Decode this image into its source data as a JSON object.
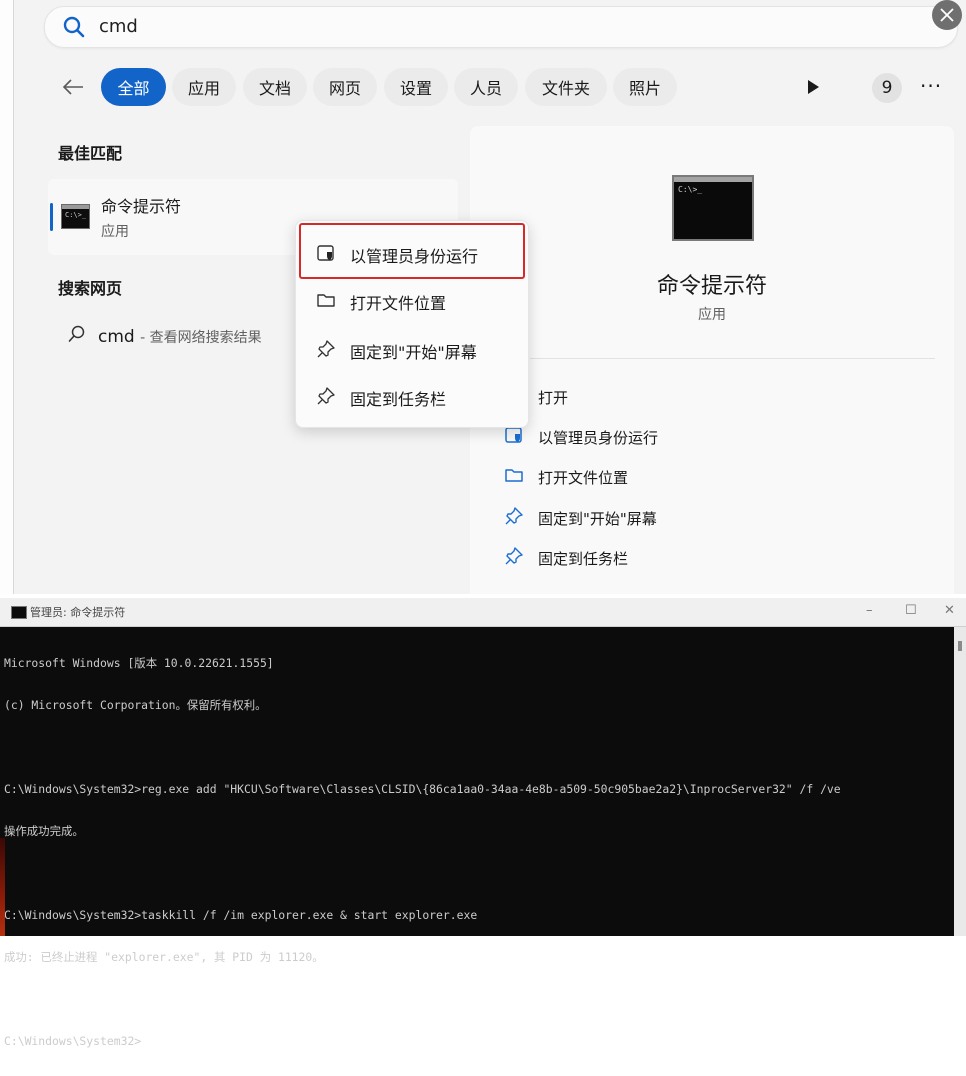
{
  "search": {
    "query": "cmd"
  },
  "filters": {
    "tabs": [
      "全部",
      "应用",
      "文档",
      "网页",
      "设置",
      "人员",
      "文件夹",
      "照片"
    ],
    "count": "9",
    "more": "···"
  },
  "results": {
    "best_match_title": "最佳匹配",
    "best_match": {
      "name": "命令提示符",
      "type": "应用"
    },
    "web_title": "搜索网页",
    "web_item": {
      "query": "cmd",
      "suffix": "- 查看网络搜索结果"
    }
  },
  "context_menu": {
    "items": [
      {
        "label": "以管理员身份运行",
        "icon": "shield-icon"
      },
      {
        "label": "打开文件位置",
        "icon": "folder-icon"
      },
      {
        "label": "固定到\"开始\"屏幕",
        "icon": "pin-icon"
      },
      {
        "label": "固定到任务栏",
        "icon": "pin-icon"
      }
    ]
  },
  "detail": {
    "name": "命令提示符",
    "type": "应用",
    "actions": [
      {
        "label": "打开",
        "icon": "open-icon"
      },
      {
        "label": "以管理员身份运行",
        "icon": "shield-icon"
      },
      {
        "label": "打开文件位置",
        "icon": "folder-icon"
      },
      {
        "label": "固定到\"开始\"屏幕",
        "icon": "pin-icon"
      },
      {
        "label": "固定到任务栏",
        "icon": "pin-icon"
      }
    ]
  },
  "cmd_window": {
    "title": "管理员: 命令提示符",
    "controls": {
      "minimize": "–",
      "maximize": "☐",
      "close": "✕"
    },
    "lines": [
      "Microsoft Windows [版本 10.0.22621.1555]",
      "(c) Microsoft Corporation。保留所有权利。",
      "",
      "C:\\Windows\\System32>reg.exe add \"HKCU\\Software\\Classes\\CLSID\\{86ca1aa0-34aa-4e8b-a509-50c905bae2a2}\\InprocServer32\" /f /ve",
      "操作成功完成。",
      "",
      "C:\\Windows\\System32>taskkill /f /im explorer.exe & start explorer.exe",
      "成功: 已终止进程 \"explorer.exe\", 其 PID 为 11120。",
      "",
      "C:\\Windows\\System32>"
    ]
  },
  "colors": {
    "accent": "#1264c8",
    "highlight_border": "#d62a2a",
    "console_bg": "#0c0c0c",
    "console_text": "#cccccc"
  }
}
